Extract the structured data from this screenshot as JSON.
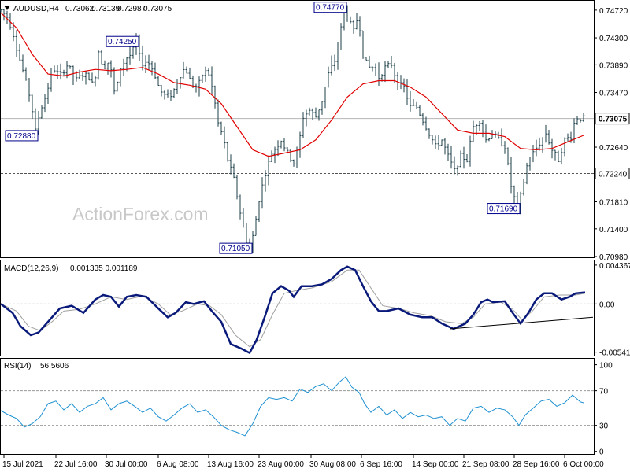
{
  "watermark": "ActionForex.com",
  "chart_data": [
    {
      "type": "candlestick",
      "symbol": "AUDUSD,H4",
      "ohlc": {
        "open": "0.73062",
        "high": "0.73139",
        "low": "0.72987",
        "close": "0.73075"
      },
      "ylim": [
        0.7098,
        0.7485
      ],
      "y_ticks": [
        "0.74720",
        "0.74300",
        "0.73890",
        "0.73470",
        "0.73075",
        "0.72640",
        "0.72240",
        "0.71810",
        "0.71400",
        "0.70980"
      ],
      "y_tick_values": [
        0.7472,
        0.743,
        0.7389,
        0.7347,
        0.73075,
        0.7264,
        0.7224,
        0.7181,
        0.714,
        0.7098
      ],
      "current_price": "0.73075",
      "current_price_value": 0.73075,
      "support_line": "0.72240",
      "support_value": 0.7224,
      "annotations": [
        {
          "label": "0.72880",
          "value": 0.7288,
          "bar": 44
        },
        {
          "label": "0.74250",
          "value": 0.7425,
          "bar": 172
        },
        {
          "label": "0.74770",
          "value": 0.7477,
          "bar": 436
        },
        {
          "label": "0.71050",
          "value": 0.7105,
          "bar": 316
        },
        {
          "label": "0.71690",
          "value": 0.7169,
          "bar": 656
        }
      ],
      "price_path": [
        [
          0,
          0.7472
        ],
        [
          8,
          0.7462
        ],
        [
          15,
          0.744
        ],
        [
          22,
          0.7405
        ],
        [
          30,
          0.7372
        ],
        [
          38,
          0.7335
        ],
        [
          44,
          0.7288
        ],
        [
          50,
          0.732
        ],
        [
          58,
          0.7345
        ],
        [
          66,
          0.7385
        ],
        [
          75,
          0.7372
        ],
        [
          85,
          0.739
        ],
        [
          95,
          0.7365
        ],
        [
          105,
          0.7375
        ],
        [
          112,
          0.737
        ],
        [
          118,
          0.7355
        ],
        [
          124,
          0.741
        ],
        [
          130,
          0.7385
        ],
        [
          138,
          0.7395
        ],
        [
          145,
          0.734
        ],
        [
          152,
          0.7385
        ],
        [
          160,
          0.74
        ],
        [
          166,
          0.7405
        ],
        [
          172,
          0.7425
        ],
        [
          178,
          0.739
        ],
        [
          186,
          0.7395
        ],
        [
          194,
          0.738
        ],
        [
          202,
          0.735
        ],
        [
          210,
          0.734
        ],
        [
          218,
          0.7345
        ],
        [
          226,
          0.737
        ],
        [
          234,
          0.7385
        ],
        [
          242,
          0.736
        ],
        [
          250,
          0.7355
        ],
        [
          258,
          0.738
        ],
        [
          264,
          0.7375
        ],
        [
          270,
          0.7345
        ],
        [
          276,
          0.73
        ],
        [
          282,
          0.728
        ],
        [
          288,
          0.7245
        ],
        [
          296,
          0.7215
        ],
        [
          304,
          0.7165
        ],
        [
          310,
          0.713
        ],
        [
          316,
          0.7105
        ],
        [
          322,
          0.714
        ],
        [
          328,
          0.7185
        ],
        [
          336,
          0.7225
        ],
        [
          344,
          0.7255
        ],
        [
          350,
          0.7265
        ],
        [
          356,
          0.7275
        ],
        [
          364,
          0.7255
        ],
        [
          372,
          0.724
        ],
        [
          378,
          0.7265
        ],
        [
          384,
          0.731
        ],
        [
          392,
          0.732
        ],
        [
          400,
          0.731
        ],
        [
          408,
          0.7335
        ],
        [
          416,
          0.7375
        ],
        [
          424,
          0.7395
        ],
        [
          430,
          0.743
        ],
        [
          436,
          0.7472
        ],
        [
          442,
          0.7455
        ],
        [
          448,
          0.744
        ],
        [
          454,
          0.7465
        ],
        [
          460,
          0.7405
        ],
        [
          466,
          0.7385
        ],
        [
          472,
          0.7385
        ],
        [
          480,
          0.737
        ],
        [
          488,
          0.7385
        ],
        [
          496,
          0.739
        ],
        [
          504,
          0.736
        ],
        [
          512,
          0.7355
        ],
        [
          520,
          0.7325
        ],
        [
          528,
          0.7325
        ],
        [
          536,
          0.7305
        ],
        [
          544,
          0.7285
        ],
        [
          552,
          0.7265
        ],
        [
          560,
          0.7275
        ],
        [
          568,
          0.725
        ],
        [
          576,
          0.7228
        ],
        [
          584,
          0.725
        ],
        [
          592,
          0.7245
        ],
        [
          600,
          0.7295
        ],
        [
          608,
          0.7305
        ],
        [
          616,
          0.7275
        ],
        [
          624,
          0.7285
        ],
        [
          632,
          0.7275
        ],
        [
          640,
          0.7265
        ],
        [
          648,
          0.7205
        ],
        [
          656,
          0.7169
        ],
        [
          662,
          0.72
        ],
        [
          668,
          0.7235
        ],
        [
          676,
          0.7255
        ],
        [
          684,
          0.727
        ],
        [
          692,
          0.7285
        ],
        [
          700,
          0.726
        ],
        [
          708,
          0.7245
        ],
        [
          716,
          0.7275
        ],
        [
          724,
          0.728
        ],
        [
          730,
          0.731
        ],
        [
          736,
          0.73075
        ]
      ],
      "ma_path": [
        [
          0,
          0.7468
        ],
        [
          20,
          0.7445
        ],
        [
          40,
          0.7405
        ],
        [
          60,
          0.7375
        ],
        [
          80,
          0.7372
        ],
        [
          100,
          0.7378
        ],
        [
          120,
          0.7382
        ],
        [
          140,
          0.738
        ],
        [
          160,
          0.7382
        ],
        [
          180,
          0.7385
        ],
        [
          200,
          0.7375
        ],
        [
          220,
          0.7362
        ],
        [
          240,
          0.7358
        ],
        [
          260,
          0.7352
        ],
        [
          280,
          0.733
        ],
        [
          300,
          0.7295
        ],
        [
          320,
          0.726
        ],
        [
          340,
          0.725
        ],
        [
          360,
          0.7255
        ],
        [
          380,
          0.726
        ],
        [
          400,
          0.7275
        ],
        [
          420,
          0.7305
        ],
        [
          440,
          0.734
        ],
        [
          460,
          0.736
        ],
        [
          480,
          0.7365
        ],
        [
          500,
          0.7365
        ],
        [
          520,
          0.7355
        ],
        [
          540,
          0.734
        ],
        [
          560,
          0.7315
        ],
        [
          580,
          0.729
        ],
        [
          600,
          0.7285
        ],
        [
          620,
          0.7285
        ],
        [
          640,
          0.728
        ],
        [
          660,
          0.7262
        ],
        [
          680,
          0.726
        ],
        [
          700,
          0.7262
        ],
        [
          720,
          0.7272
        ],
        [
          740,
          0.7282
        ]
      ]
    },
    {
      "type": "line",
      "indicator": "MACD(12,26,9)",
      "values_text": "0.001335 0.001189",
      "ylim": [
        -0.0058,
        0.0048
      ],
      "y_ticks": [
        "0.004367",
        "0.00",
        "-0.005411"
      ],
      "y_tick_values": [
        0.004367,
        0.0,
        -0.005411
      ],
      "macd": [
        [
          0,
          0.0
        ],
        [
          15,
          -0.001
        ],
        [
          25,
          -0.0025
        ],
        [
          38,
          -0.0035
        ],
        [
          48,
          -0.0032
        ],
        [
          60,
          -0.002
        ],
        [
          75,
          -0.0005
        ],
        [
          90,
          -0.0002
        ],
        [
          105,
          -0.001
        ],
        [
          120,
          0.0005
        ],
        [
          130,
          0.001
        ],
        [
          140,
          0.0008
        ],
        [
          150,
          -0.0003
        ],
        [
          160,
          0.0008
        ],
        [
          172,
          0.001
        ],
        [
          185,
          0.0008
        ],
        [
          200,
          -0.0005
        ],
        [
          212,
          -0.0015
        ],
        [
          222,
          -0.001
        ],
        [
          235,
          0.0002
        ],
        [
          245,
          0.0
        ],
        [
          258,
          0.0003
        ],
        [
          268,
          -0.0008
        ],
        [
          280,
          -0.002
        ],
        [
          292,
          -0.0045
        ],
        [
          305,
          -0.005
        ],
        [
          316,
          -0.0055
        ],
        [
          325,
          -0.004
        ],
        [
          335,
          -0.0015
        ],
        [
          345,
          0.0012
        ],
        [
          356,
          0.002
        ],
        [
          366,
          0.0015
        ],
        [
          372,
          0.0008
        ],
        [
          382,
          0.002
        ],
        [
          395,
          0.002
        ],
        [
          408,
          0.0022
        ],
        [
          420,
          0.0028
        ],
        [
          432,
          0.0038
        ],
        [
          440,
          0.0042
        ],
        [
          450,
          0.0038
        ],
        [
          460,
          0.002
        ],
        [
          470,
          0.0003
        ],
        [
          480,
          -0.0008
        ],
        [
          490,
          -0.0008
        ],
        [
          505,
          -0.0005
        ],
        [
          520,
          -0.0012
        ],
        [
          535,
          -0.0015
        ],
        [
          548,
          -0.0015
        ],
        [
          560,
          -0.0022
        ],
        [
          575,
          -0.0028
        ],
        [
          590,
          -0.0022
        ],
        [
          600,
          -0.0012
        ],
        [
          610,
          0.0002
        ],
        [
          618,
          0.0005
        ],
        [
          625,
          0.0002
        ],
        [
          640,
          0.0003
        ],
        [
          650,
          -0.001
        ],
        [
          660,
          -0.0022
        ],
        [
          670,
          -0.001
        ],
        [
          680,
          0.0005
        ],
        [
          690,
          0.0012
        ],
        [
          700,
          0.0012
        ],
        [
          712,
          0.0005
        ],
        [
          722,
          0.0008
        ],
        [
          730,
          0.0012
        ],
        [
          742,
          0.0013
        ]
      ],
      "signal": [
        [
          0,
          0.0
        ],
        [
          20,
          -0.0008
        ],
        [
          35,
          -0.0025
        ],
        [
          50,
          -0.003
        ],
        [
          65,
          -0.002
        ],
        [
          80,
          -0.0008
        ],
        [
          100,
          -0.0006
        ],
        [
          120,
          0.0
        ],
        [
          140,
          0.0008
        ],
        [
          160,
          0.0005
        ],
        [
          180,
          0.0009
        ],
        [
          200,
          0.0
        ],
        [
          215,
          -0.0012
        ],
        [
          230,
          -0.0008
        ],
        [
          250,
          0.0
        ],
        [
          265,
          -0.0002
        ],
        [
          280,
          -0.0012
        ],
        [
          298,
          -0.0035
        ],
        [
          316,
          -0.0048
        ],
        [
          330,
          -0.004
        ],
        [
          345,
          -0.0012
        ],
        [
          360,
          0.0012
        ],
        [
          375,
          0.0015
        ],
        [
          395,
          0.0018
        ],
        [
          420,
          0.0025
        ],
        [
          440,
          0.0038
        ],
        [
          455,
          0.0038
        ],
        [
          470,
          0.0018
        ],
        [
          485,
          -0.0002
        ],
        [
          505,
          -0.0005
        ],
        [
          525,
          -0.001
        ],
        [
          545,
          -0.0013
        ],
        [
          565,
          -0.002
        ],
        [
          585,
          -0.0022
        ],
        [
          600,
          -0.0015
        ],
        [
          615,
          0.0
        ],
        [
          635,
          0.0002
        ],
        [
          650,
          -0.0006
        ],
        [
          662,
          -0.0018
        ],
        [
          675,
          -0.0008
        ],
        [
          690,
          0.0008
        ],
        [
          710,
          0.001
        ],
        [
          730,
          0.001
        ],
        [
          742,
          0.0012
        ]
      ],
      "trendline": [
        [
          570,
          -0.0028
        ],
        [
          752,
          -0.0015
        ]
      ]
    },
    {
      "type": "line",
      "indicator": "RSI(14)",
      "values_text": "56.5606",
      "ylim": [
        -3,
        106
      ],
      "y_ticks": [
        "100",
        "70",
        "30",
        "0"
      ],
      "y_tick_values": [
        100,
        70,
        30,
        0
      ],
      "levels": [
        70,
        30
      ],
      "rsi": [
        [
          0,
          47
        ],
        [
          10,
          42
        ],
        [
          20,
          38
        ],
        [
          30,
          28
        ],
        [
          40,
          32
        ],
        [
          50,
          40
        ],
        [
          60,
          55
        ],
        [
          70,
          58
        ],
        [
          80,
          48
        ],
        [
          90,
          55
        ],
        [
          100,
          45
        ],
        [
          110,
          52
        ],
        [
          120,
          55
        ],
        [
          130,
          62
        ],
        [
          140,
          48
        ],
        [
          150,
          55
        ],
        [
          160,
          58
        ],
        [
          170,
          52
        ],
        [
          180,
          45
        ],
        [
          190,
          50
        ],
        [
          200,
          40
        ],
        [
          210,
          35
        ],
        [
          220,
          42
        ],
        [
          230,
          50
        ],
        [
          240,
          55
        ],
        [
          250,
          45
        ],
        [
          260,
          48
        ],
        [
          270,
          40
        ],
        [
          280,
          30
        ],
        [
          290,
          25
        ],
        [
          300,
          22
        ],
        [
          310,
          18
        ],
        [
          320,
          32
        ],
        [
          330,
          52
        ],
        [
          340,
          62
        ],
        [
          350,
          60
        ],
        [
          360,
          62
        ],
        [
          370,
          58
        ],
        [
          380,
          72
        ],
        [
          390,
          68
        ],
        [
          400,
          75
        ],
        [
          410,
          78
        ],
        [
          420,
          70
        ],
        [
          430,
          80
        ],
        [
          438,
          86
        ],
        [
          446,
          74
        ],
        [
          455,
          68
        ],
        [
          462,
          55
        ],
        [
          470,
          45
        ],
        [
          480,
          52
        ],
        [
          490,
          42
        ],
        [
          500,
          48
        ],
        [
          510,
          38
        ],
        [
          520,
          45
        ],
        [
          530,
          40
        ],
        [
          540,
          42
        ],
        [
          550,
          38
        ],
        [
          560,
          40
        ],
        [
          570,
          30
        ],
        [
          580,
          38
        ],
        [
          590,
          35
        ],
        [
          600,
          50
        ],
        [
          610,
          52
        ],
        [
          620,
          45
        ],
        [
          630,
          50
        ],
        [
          640,
          48
        ],
        [
          650,
          40
        ],
        [
          658,
          30
        ],
        [
          666,
          42
        ],
        [
          676,
          50
        ],
        [
          686,
          58
        ],
        [
          696,
          60
        ],
        [
          706,
          52
        ],
        [
          716,
          56
        ],
        [
          726,
          65
        ],
        [
          736,
          57
        ],
        [
          740,
          56
        ]
      ]
    }
  ],
  "x_axis": {
    "labels": [
      "15 Jul 2021",
      "22 Jul 16:00",
      "30 Jul 00:00",
      "6 Aug 08:00",
      "13 Aug 16:00",
      "23 Aug 00:00",
      "30 Aug 08:00",
      "6 Sep 16:00",
      "14 Sep 00:00",
      "21 Sep 08:00",
      "28 Sep 16:00",
      "6 Oct 00:00"
    ],
    "label_bars": [
      4,
      70,
      134,
      200,
      264,
      328,
      394,
      458,
      524,
      588,
      652,
      716
    ]
  }
}
